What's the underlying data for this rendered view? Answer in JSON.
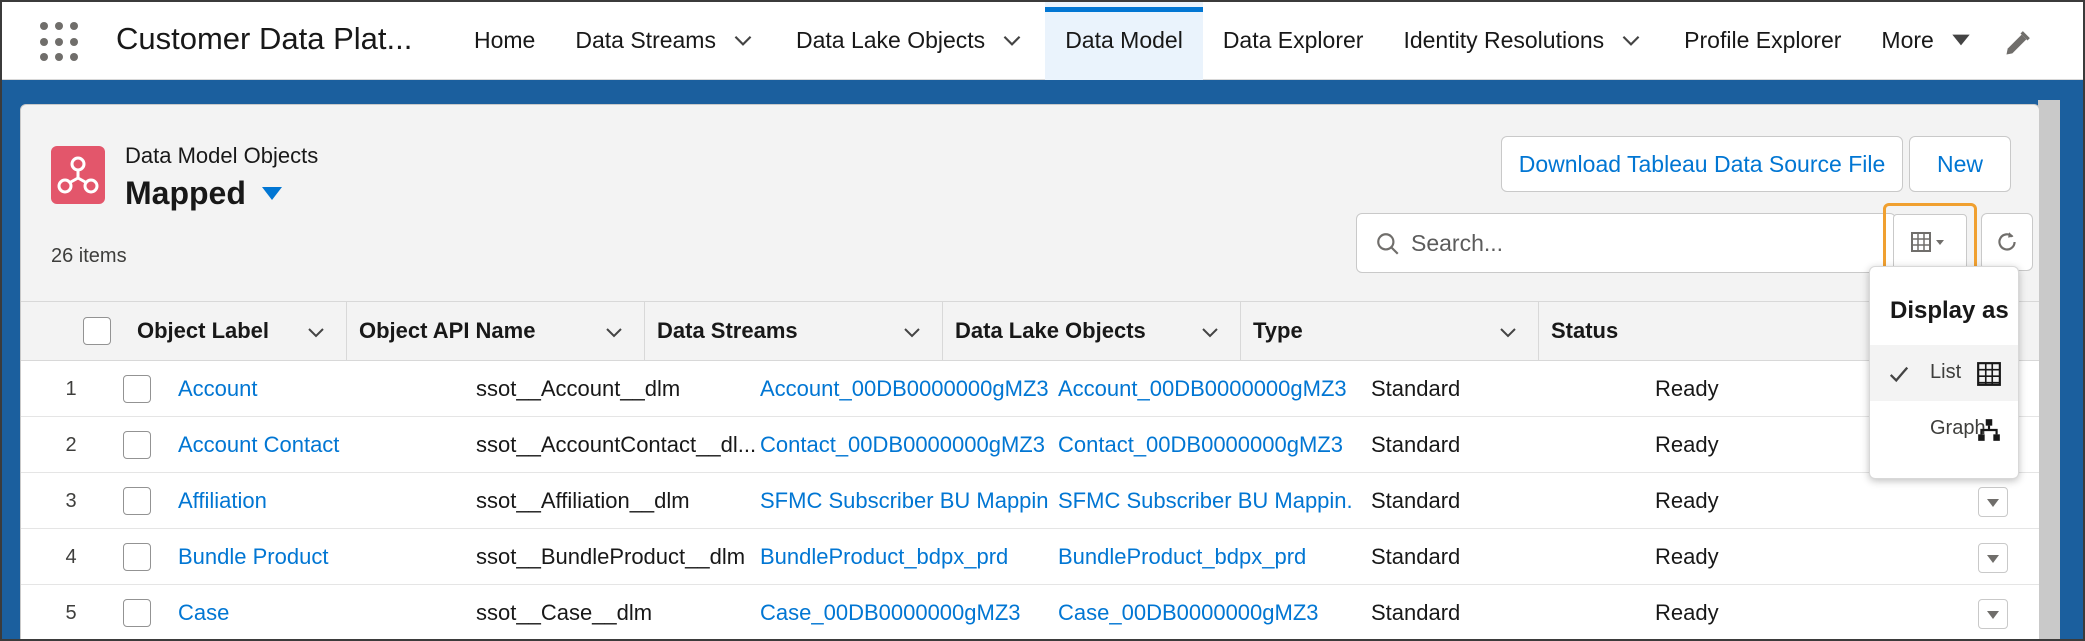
{
  "app": {
    "name": "Customer Data Plat..."
  },
  "nav": {
    "items": [
      {
        "label": "Home",
        "has_menu": false,
        "active": false
      },
      {
        "label": "Data Streams",
        "has_menu": true,
        "active": false
      },
      {
        "label": "Data Lake Objects",
        "has_menu": true,
        "active": false
      },
      {
        "label": "Data Model",
        "has_menu": false,
        "active": true
      },
      {
        "label": "Data Explorer",
        "has_menu": false,
        "active": false
      },
      {
        "label": "Identity Resolutions",
        "has_menu": true,
        "active": false
      },
      {
        "label": "Profile Explorer",
        "has_menu": false,
        "active": false
      },
      {
        "label": "More",
        "has_menu": true,
        "active": false
      }
    ]
  },
  "header": {
    "object_type": "Data Model Objects",
    "view_name": "Mapped",
    "item_count": "26 items",
    "download_button": "Download Tableau Data Source File",
    "new_button": "New",
    "search_placeholder": "Search..."
  },
  "table": {
    "columns": [
      "Object Label",
      "Object API Name",
      "Data Streams",
      "Data Lake Objects",
      "Type",
      "Status"
    ],
    "rows": [
      {
        "num": "1",
        "label": "Account",
        "api": "ssot__Account__dlm",
        "stream": "Account_00DB0000000gMZ3",
        "dlo": "Account_00DB0000000gMZ3",
        "type": "Standard",
        "status": "Ready"
      },
      {
        "num": "2",
        "label": "Account Contact",
        "api": "ssot__AccountContact__dl...",
        "stream": "Contact_00DB0000000gMZ3",
        "dlo": "Contact_00DB0000000gMZ3",
        "type": "Standard",
        "status": "Ready"
      },
      {
        "num": "3",
        "label": "Affiliation",
        "api": "ssot__Affiliation__dlm",
        "stream": "SFMC Subscriber BU Mappin...",
        "dlo": "SFMC Subscriber BU Mappin...",
        "type": "Standard",
        "status": "Ready"
      },
      {
        "num": "4",
        "label": "Bundle Product",
        "api": "ssot__BundleProduct__dlm",
        "stream": "BundleProduct_bdpx_prd",
        "dlo": "BundleProduct_bdpx_prd",
        "type": "Standard",
        "status": "Ready"
      },
      {
        "num": "5",
        "label": "Case",
        "api": "ssot__Case__dlm",
        "stream": "Case_00DB0000000gMZ3",
        "dlo": "Case_00DB0000000gMZ3",
        "type": "Standard",
        "status": "Ready"
      }
    ]
  },
  "display_menu": {
    "heading": "Display as",
    "options": [
      {
        "label": "List",
        "icon": "table-icon",
        "selected": true
      },
      {
        "label": "Graph",
        "icon": "hierarchy-icon",
        "selected": false
      }
    ]
  },
  "colors": {
    "accent": "#0176d3",
    "object_icon": "#e3566b",
    "highlight_outline": "#f0a030",
    "background_band": "#1b5f9e"
  }
}
